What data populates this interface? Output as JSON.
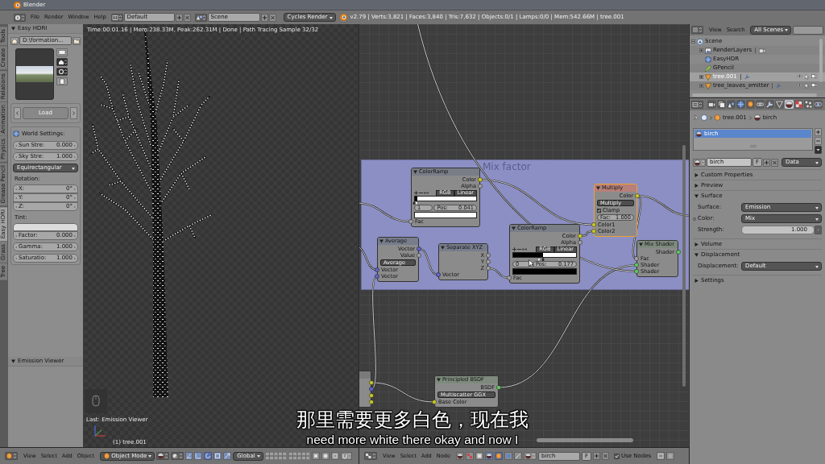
{
  "window": {
    "title": "Blender"
  },
  "info_header": {
    "menus": [
      "File",
      "Render",
      "Window",
      "Help"
    ],
    "layout": "Default",
    "scene": "Scene",
    "engine": "Cycles Render",
    "stats": "v2.79 | Verts:3,821 | Faces:3,840 | Tris:7,632 | Objects:0/1 | Lamps:0/0 | Mem:542.66M | tree.001"
  },
  "tool_tabs": [
    {
      "label": "Tools",
      "selected": false
    },
    {
      "label": "Create",
      "selected": false
    },
    {
      "label": "Relations",
      "selected": false
    },
    {
      "label": "Animation",
      "selected": false
    },
    {
      "label": "Physics",
      "selected": false
    },
    {
      "label": "Grease Pencil",
      "selected": false
    },
    {
      "label": "Easy HDRI",
      "selected": true
    },
    {
      "label": "Grass",
      "selected": false
    },
    {
      "label": "Tree",
      "selected": false
    }
  ],
  "easy_hdri": {
    "title": "Easy HDRI",
    "expanded": true,
    "path": "D:\\formation...",
    "load": {
      "label": "Load",
      "disabled": true
    },
    "world_title": "World Settings:",
    "strengths": [
      {
        "label": "Sun Stre:",
        "value": "0.000"
      },
      {
        "label": "Sky Stre:",
        "value": "1.000"
      }
    ],
    "mapping": "Equirectangular",
    "rotation_title": "Rotation:",
    "rotation": [
      {
        "label": "X:",
        "value": "0°"
      },
      {
        "label": "Y:",
        "value": "0°"
      },
      {
        "label": "Z:",
        "value": "0°"
      }
    ],
    "tint_title": "Tint:",
    "factor": {
      "label": "Factor:",
      "value": "0.000"
    },
    "adjustments": [
      {
        "label": "Gamma:",
        "value": "1.000"
      },
      {
        "label": "Saturatio:",
        "value": "1.000"
      }
    ]
  },
  "emission_viewer": {
    "title": "Emission Viewer",
    "expanded": true
  },
  "viewport": {
    "render_info": "Time:00:01.16 | Mem:238.33M, Peak:262.31M | Done | Path Tracing Sample 32/32",
    "last_operator": "Last: Emission Viewer",
    "object_info": "(1) tree.001"
  },
  "view3d_header": {
    "menus": [
      "View",
      "Select",
      "Add",
      "Object"
    ],
    "mode": "Object Mode",
    "orientation": "Global"
  },
  "node_editor": {
    "frame": {
      "label": "Mix factor"
    },
    "nodes": [
      {
        "kind": "color_ramp",
        "title": "ColorRamp",
        "expanded": true,
        "selected": false,
        "outputs": [
          {
            "label": "Color",
            "color": "#c7c729"
          },
          {
            "label": "Alpha",
            "color": "#a1a1a1"
          }
        ],
        "modes": [
          "RGB",
          "Linear"
        ],
        "stops": [
          {
            "color": "#000000",
            "level": 0,
            "selected": false
          },
          {
            "color": "#ffffff",
            "level": 0.041,
            "selected": true
          }
        ],
        "stop_index": "1",
        "position": {
          "label": "Pos:",
          "value": "0.041"
        },
        "inputs": [
          {
            "label": "Fac",
            "color": "#a1a1a1"
          }
        ]
      },
      {
        "kind": "mix_rgb",
        "title": "Multiply",
        "expanded": true,
        "selected": true,
        "outputs": [
          {
            "label": "Color",
            "color": "#c7c729"
          }
        ],
        "menu": "Multiply",
        "clamp": {
          "label": "Clamp",
          "checked": true
        },
        "factor": {
          "label": "Fac:",
          "value": "1.000"
        },
        "inputs": [
          {
            "label": "Color1",
            "color": "#c7c729"
          },
          {
            "label": "Color2",
            "color": "#c7c729"
          }
        ]
      },
      {
        "kind": "vector_math",
        "title": "Average",
        "expanded": true,
        "selected": false,
        "outputs": [
          {
            "label": "Vector",
            "color": "#6363c7"
          },
          {
            "label": "Value",
            "color": "#a1a1a1"
          }
        ],
        "menu": "Average",
        "inputs": [
          {
            "label": "Vector",
            "color": "#6363c7"
          },
          {
            "label": "Vector",
            "color": "#6363c7"
          }
        ]
      },
      {
        "kind": "separate_xyz",
        "title": "Separate XYZ",
        "expanded": true,
        "selected": false,
        "outputs": [
          {
            "label": "X",
            "color": "#a1a1a1"
          },
          {
            "label": "Y",
            "color": "#a1a1a1"
          },
          {
            "label": "Z",
            "color": "#a1a1a1"
          }
        ],
        "inputs": [
          {
            "label": "Vector",
            "color": "#6363c7"
          }
        ]
      },
      {
        "kind": "color_ramp",
        "title": "ColorRamp",
        "expanded": true,
        "selected": false,
        "outputs": [
          {
            "label": "Color",
            "color": "#c7c729"
          },
          {
            "label": "Alpha",
            "color": "#a1a1a1"
          }
        ],
        "modes": [
          "RGB",
          "Linear"
        ],
        "stops": [
          {
            "color": "#000000",
            "level": 0.41,
            "selected": true
          },
          {
            "color": "#ffffff",
            "level": 0.48,
            "selected": false
          }
        ],
        "stop_index": "0",
        "position": {
          "label": "Pos:",
          "value": "0.177"
        },
        "inputs": [
          {
            "label": "Fac",
            "color": "#a1a1a1"
          }
        ]
      },
      {
        "kind": "mix_shader",
        "title": "Mix Shader",
        "expanded": true,
        "selected": false,
        "outputs": [
          {
            "label": "Shader",
            "color": "#63c763"
          }
        ],
        "inputs": [
          {
            "label": "Fac",
            "color": "#a1a1a1"
          },
          {
            "label": "Shader",
            "color": "#63c763"
          },
          {
            "label": "Shader",
            "color": "#63c763"
          }
        ]
      },
      {
        "kind": "partial",
        "selected": false,
        "outputs": [
          {
            "color": "#c7c729"
          },
          {
            "color": "#6363c7"
          },
          {
            "color": "#c7c729"
          },
          {
            "color": "#c7c729"
          }
        ]
      },
      {
        "kind": "principled",
        "title": "Principled BSDF",
        "expanded": true,
        "selected": false,
        "outputs": [
          {
            "label": "BSDF",
            "color": "#63c763"
          }
        ],
        "menu": "Multiscatter GGX",
        "inputs": [
          {
            "label": "Base Color",
            "color": "#c7c729"
          }
        ]
      }
    ]
  },
  "node_header": {
    "menus": [
      "View",
      "Select",
      "Add",
      "Node"
    ],
    "material": "birch",
    "fake_user": "F",
    "use_nodes": {
      "label": "Use Nodes",
      "checked": true
    }
  },
  "outliner": {
    "menus": [
      "View",
      "Search"
    ],
    "filter": "All Scenes",
    "items": [
      {
        "label": "Scene",
        "kind": "scene",
        "expanded": true,
        "selected": false,
        "children": [
          {
            "label": "RenderLayers",
            "kind": "render_layers",
            "expanded": false,
            "selected": false
          },
          {
            "label": "EasyHDR",
            "kind": "world",
            "selected": false
          },
          {
            "label": "GPencil",
            "kind": "grease_pencil",
            "selected": false
          },
          {
            "label": "tree.001",
            "kind": "object",
            "expanded": false,
            "selected": true
          },
          {
            "label": "tree_leaves_emitter",
            "kind": "object",
            "expanded": false,
            "selected": false
          }
        ]
      }
    ]
  },
  "properties": {
    "tabs": [
      {
        "kind": "render",
        "selected": false
      },
      {
        "kind": "render_layers",
        "selected": false
      },
      {
        "kind": "scene",
        "selected": false
      },
      {
        "kind": "world",
        "selected": false
      },
      {
        "kind": "object",
        "selected": false
      },
      {
        "kind": "constraints",
        "selected": false
      },
      {
        "kind": "modifiers",
        "selected": false
      },
      {
        "kind": "data",
        "selected": false
      },
      {
        "kind": "material",
        "selected": true
      },
      {
        "kind": "texture",
        "selected": false
      },
      {
        "kind": "particles",
        "selected": false
      },
      {
        "kind": "physics",
        "selected": false
      }
    ],
    "breadcrumb": [
      "tree.001",
      "birch"
    ],
    "slots": [
      {
        "label": "birch",
        "selected": true
      }
    ],
    "material": {
      "name": "birch",
      "fake_user": "F",
      "link": "Data"
    },
    "panels": [
      {
        "title": "Custom Properties",
        "expanded": false
      },
      {
        "title": "Preview",
        "expanded": false
      },
      {
        "title": "Surface",
        "expanded": true,
        "rows": [
          {
            "kind": "menu",
            "label": "Surface:",
            "value": "Emission",
            "linked": false
          },
          {
            "kind": "menu",
            "label": "Color:",
            "value": "Mix",
            "linked": true
          },
          {
            "kind": "number",
            "label": "Strength:",
            "value": "1.000",
            "linked": false
          }
        ]
      },
      {
        "title": "Volume",
        "expanded": false
      },
      {
        "title": "Displacement",
        "expanded": true,
        "rows": [
          {
            "kind": "menu",
            "label": "Displacement:",
            "value": "Default",
            "linked": false
          }
        ]
      },
      {
        "title": "Settings",
        "expanded": false
      }
    ]
  },
  "subtitles": [
    "那里需要更多白色，现在我",
    "need more white there okay and now I"
  ]
}
